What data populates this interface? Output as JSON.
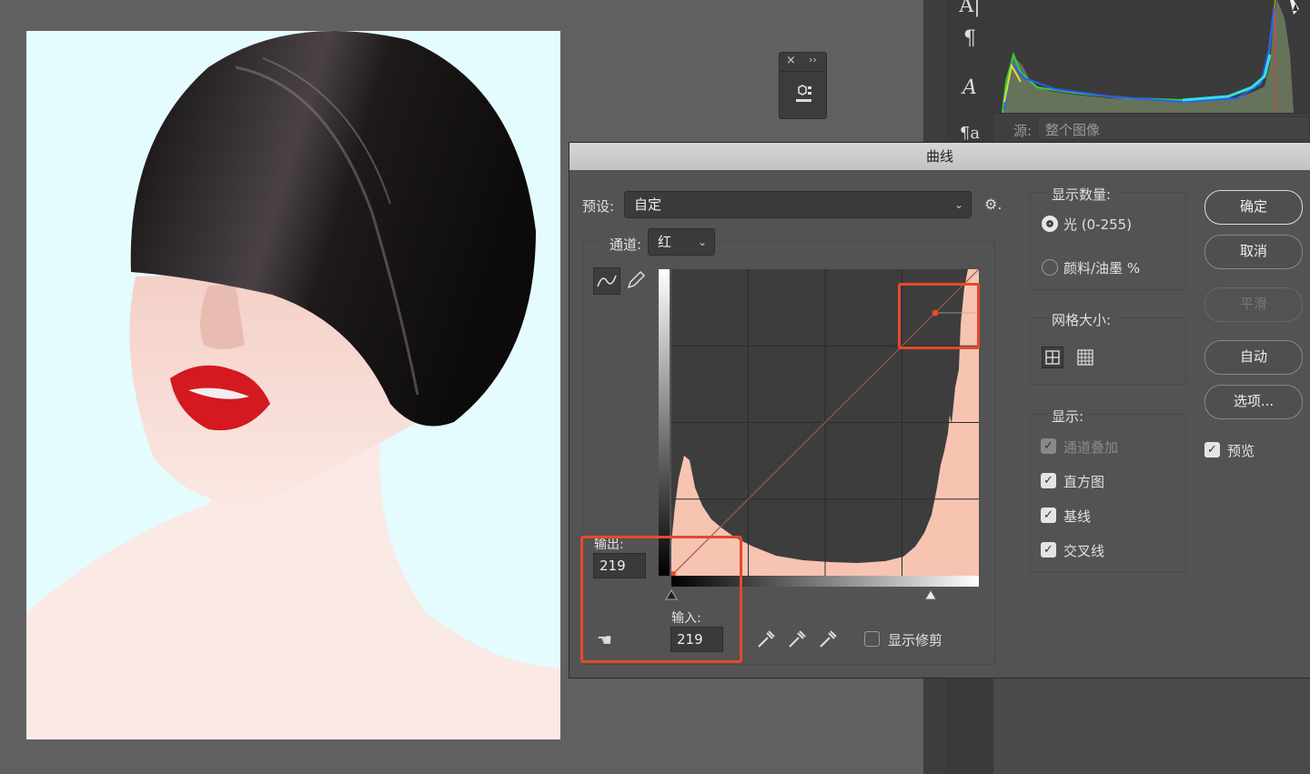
{
  "right_panel": {
    "source_label": "源:",
    "source_value": "整个图像"
  },
  "curves_dialog": {
    "title": "曲线",
    "preset_label": "预设:",
    "preset_value": "自定",
    "channel_label": "通道:",
    "channel_value": "红",
    "output_label": "输出:",
    "output_value": "219",
    "input_label": "输入:",
    "input_value": "219",
    "show_clipping_label": "显示修剪",
    "show_clipping_checked": false,
    "show_amount": {
      "title": "显示数量:",
      "options": [
        "光 (0-255)",
        "颜料/油墨 %"
      ],
      "selected": "光 (0-255)"
    },
    "grid_size": {
      "title": "网格大小:"
    },
    "display": {
      "title": "显示:",
      "options": [
        {
          "label": "通道叠加",
          "checked": true,
          "enabled": false
        },
        {
          "label": "直方图",
          "checked": true,
          "enabled": true
        },
        {
          "label": "基线",
          "checked": true,
          "enabled": true
        },
        {
          "label": "交叉线",
          "checked": true,
          "enabled": true
        }
      ]
    },
    "buttons": {
      "ok": "确定",
      "cancel": "取消",
      "smooth": "平滑",
      "auto": "自动",
      "options": "选项..."
    },
    "preview_label": "预览",
    "preview_checked": true,
    "histogram_color": "#f7c4b2",
    "highlight_color": "#e34b2b",
    "curve_color": "#c0392b"
  }
}
